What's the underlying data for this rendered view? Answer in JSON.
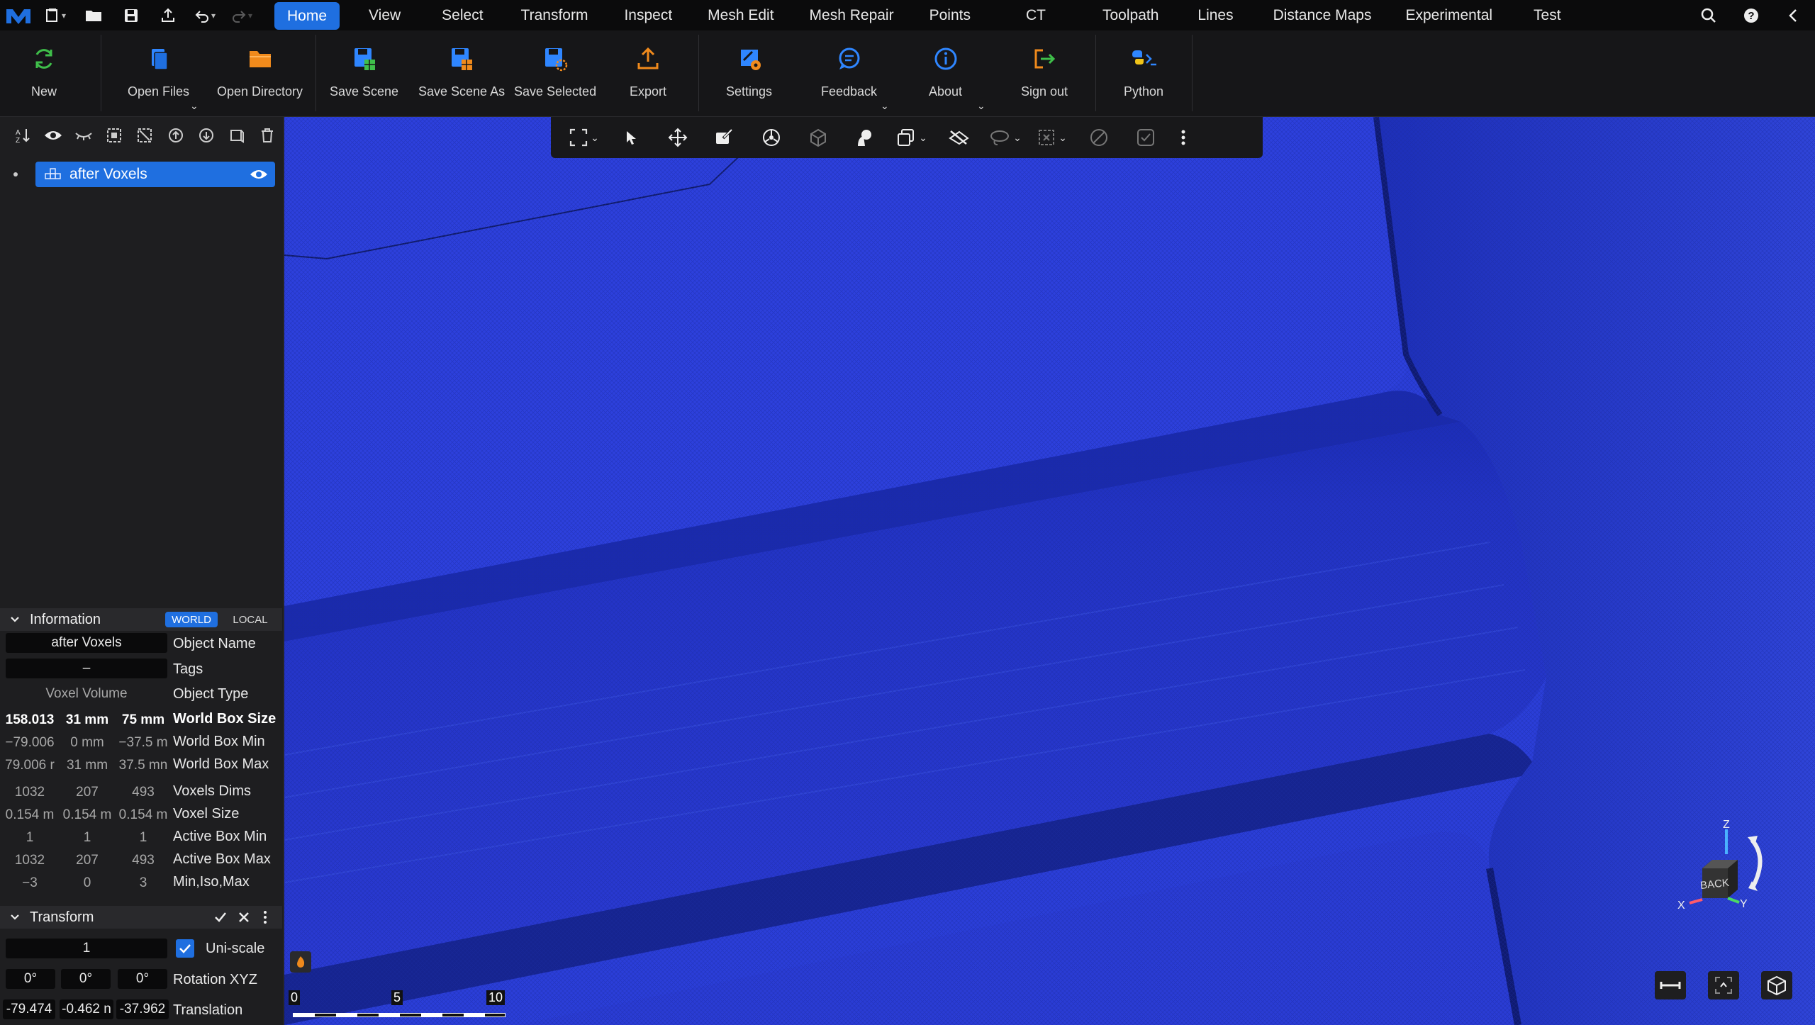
{
  "menu": {
    "tabs": [
      {
        "label": "Home",
        "active": true
      },
      {
        "label": "View"
      },
      {
        "label": "Select"
      },
      {
        "label": "Transform"
      },
      {
        "label": "Inspect"
      },
      {
        "label": "Mesh Edit"
      },
      {
        "label": "Mesh Repair"
      },
      {
        "label": "Points"
      },
      {
        "label": "CT"
      },
      {
        "label": "Toolpath"
      },
      {
        "label": "Lines"
      },
      {
        "label": "Distance Maps"
      },
      {
        "label": "Experimental"
      },
      {
        "label": "Test"
      }
    ],
    "help_label": "?"
  },
  "ribbon": {
    "new": "New",
    "open_files": "Open Files",
    "open_directory": "Open Directory",
    "save_scene": "Save Scene",
    "save_scene_as": "Save Scene As",
    "save_selected": "Save Selected",
    "export": "Export",
    "settings": "Settings",
    "feedback": "Feedback",
    "about": "About",
    "sign_out": "Sign out",
    "python": "Python"
  },
  "colors": {
    "accent": "#1f6fe0",
    "viewport_mesh": "#2a3fd9",
    "orange_icon": "#f08a1c",
    "green_icon": "#3fbf4a"
  },
  "scene": {
    "item_name": "after Voxels"
  },
  "information": {
    "title": "Information",
    "world_label": "WORLD",
    "local_label": "LOCAL",
    "object_name_value": "after Voxels",
    "object_name_label": "Object Name",
    "tags_value": "–",
    "tags_label": "Tags",
    "object_type_value": "Voxel Volume",
    "object_type_label": "Object Type",
    "rows": [
      {
        "label": "World Box Size",
        "bold": true,
        "values": [
          "158.013",
          "31 mm",
          "75 mm"
        ]
      },
      {
        "label": "World Box Min",
        "values": [
          "−79.006",
          "0 mm",
          "−37.5 m"
        ]
      },
      {
        "label": "World Box Max",
        "values": [
          "79.006 r",
          "31 mm",
          "37.5 mn"
        ]
      },
      {
        "label": "Voxels Dims",
        "values": [
          "1032",
          "207",
          "493"
        ]
      },
      {
        "label": "Voxel Size",
        "values": [
          "0.154 m",
          "0.154 m",
          "0.154 m"
        ]
      },
      {
        "label": "Active Box Min",
        "values": [
          "1",
          "1",
          "1"
        ]
      },
      {
        "label": "Active Box Max",
        "values": [
          "1032",
          "207",
          "493"
        ]
      },
      {
        "label": "Min,Iso,Max",
        "values": [
          "−3",
          "0",
          "3"
        ]
      }
    ]
  },
  "transform": {
    "title": "Transform",
    "scale_value": "1",
    "uniscale_label": "Uni-scale",
    "rotation": [
      "0°",
      "0°",
      "0°"
    ],
    "rotation_label": "Rotation XYZ",
    "translation": [
      "-79.474",
      "-0.462 n",
      "-37.962"
    ],
    "translation_label": "Translation"
  },
  "viewport": {
    "scale_labels": [
      "0",
      "5",
      "10"
    ],
    "view_cube_face": "BACK",
    "axis_x": "X",
    "axis_y": "Y",
    "axis_z": "Z"
  }
}
